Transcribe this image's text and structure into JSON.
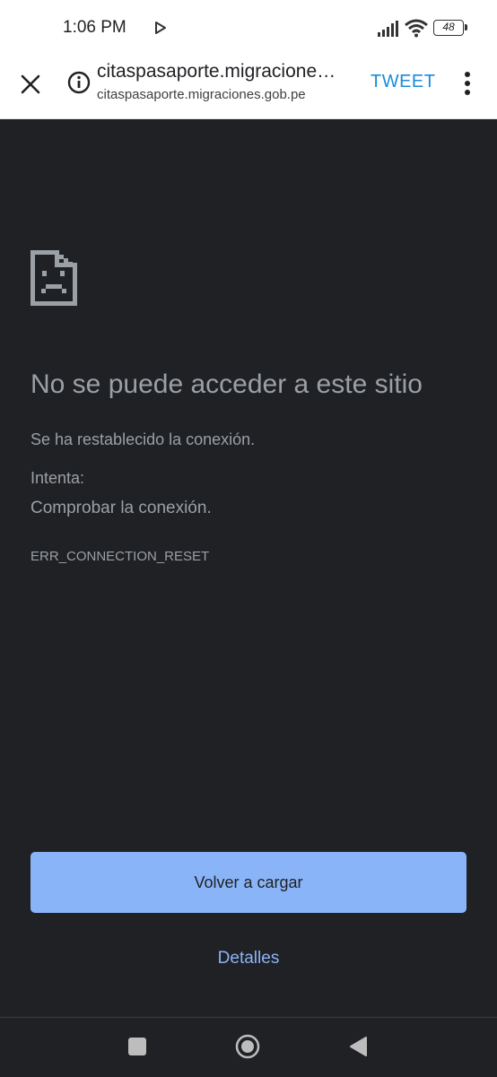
{
  "status_bar": {
    "time": "1:06 PM",
    "battery": "48"
  },
  "toolbar": {
    "title": "citaspasaporte.migracione…",
    "url": "citaspasaporte.migraciones.gob.pe",
    "tweet_label": "TWEET"
  },
  "error": {
    "heading": "No se puede acceder a este sitio",
    "description": "Se ha restablecido la conexión.",
    "try_label": "Intenta:",
    "suggestion": "Comprobar la conexión.",
    "code": "ERR_CONNECTION_RESET"
  },
  "actions": {
    "reload_label": "Volver a cargar",
    "details_label": "Detalles"
  },
  "icons": {
    "close": "close-icon",
    "info": "info-icon",
    "menu": "more-vert-icon",
    "error": "sad-page-icon",
    "signal": "signal-icon",
    "wifi": "wifi-icon",
    "battery": "battery-icon",
    "play": "play-icon",
    "nav_recent": "square-icon",
    "nav_home": "circle-icon",
    "nav_back": "triangle-back-icon"
  },
  "colors": {
    "background": "#202124",
    "text_muted": "#9aa0a6",
    "accent_button": "#8ab4f8",
    "tweet": "#1a8cd8"
  }
}
